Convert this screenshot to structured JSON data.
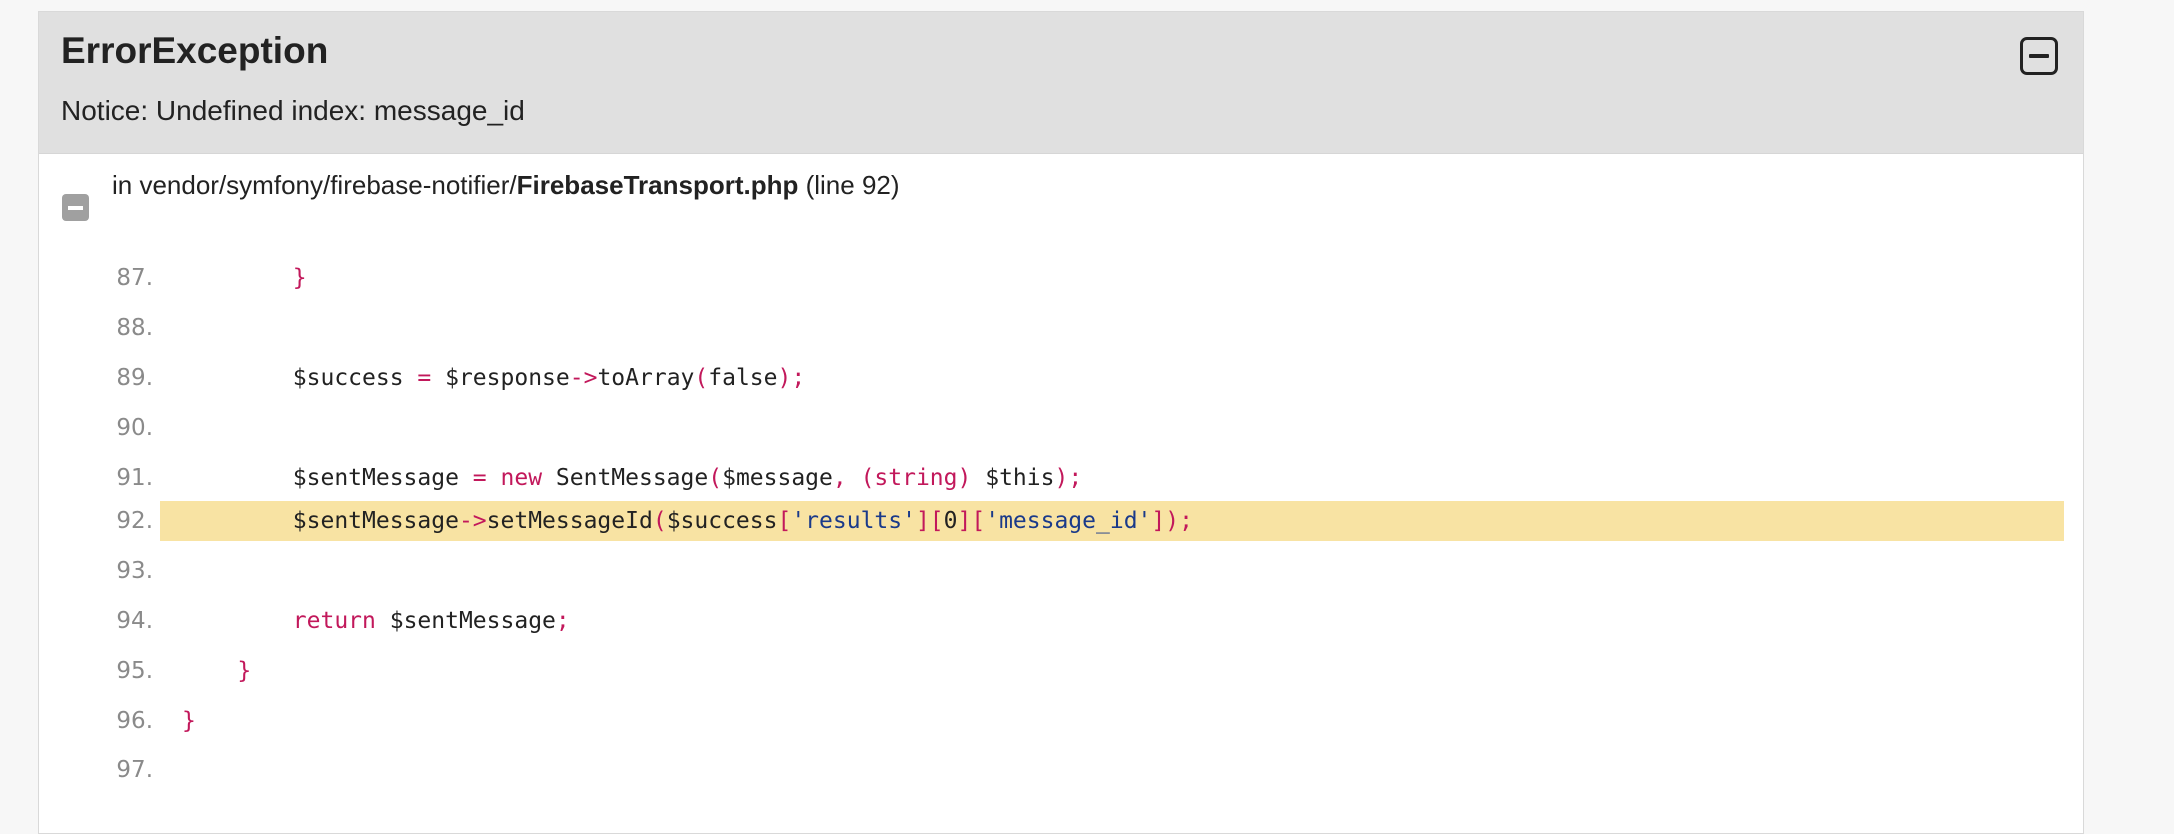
{
  "exception": {
    "class": "ErrorException",
    "message": "Notice: Undefined index: message_id"
  },
  "trace": {
    "location_prefix": "in vendor/symfony/firebase-notifier/",
    "file": "FirebaseTransport.php",
    "line_label": "(line 92)"
  },
  "icons": {
    "collapse": "minus-square-icon",
    "trace_toggle": "minus-square-icon"
  },
  "colors": {
    "header_bg": "#e0e0e0",
    "highlight_bg": "#f8e3a3",
    "punctuation": "#c2185b",
    "string": "#1a3a8a"
  },
  "code": {
    "highlighted_line": "92.",
    "lines": [
      {
        "num": "87.",
        "tokens": [
          {
            "t": "        ",
            "c": "v"
          },
          {
            "t": "}",
            "c": "p"
          }
        ]
      },
      {
        "num": "88.",
        "tokens": []
      },
      {
        "num": "89.",
        "tokens": [
          {
            "t": "        $success ",
            "c": "v"
          },
          {
            "t": "=",
            "c": "p"
          },
          {
            "t": " $response",
            "c": "v"
          },
          {
            "t": "->",
            "c": "p"
          },
          {
            "t": "toArray",
            "c": "v"
          },
          {
            "t": "(",
            "c": "p"
          },
          {
            "t": "false",
            "c": "v"
          },
          {
            "t": ");",
            "c": "p"
          }
        ]
      },
      {
        "num": "90.",
        "tokens": []
      },
      {
        "num": "91.",
        "tokens": [
          {
            "t": "        $sentMessage ",
            "c": "v"
          },
          {
            "t": "=",
            "c": "p"
          },
          {
            "t": " ",
            "c": "v"
          },
          {
            "t": "new",
            "c": "k"
          },
          {
            "t": " SentMessage",
            "c": "v"
          },
          {
            "t": "(",
            "c": "p"
          },
          {
            "t": "$message",
            "c": "v"
          },
          {
            "t": ", (",
            "c": "p"
          },
          {
            "t": "string",
            "c": "k"
          },
          {
            "t": ")",
            "c": "p"
          },
          {
            "t": " $this",
            "c": "v"
          },
          {
            "t": ");",
            "c": "p"
          }
        ]
      },
      {
        "num": "92.",
        "tokens": [
          {
            "t": "        $sentMessage",
            "c": "v"
          },
          {
            "t": "->",
            "c": "p"
          },
          {
            "t": "setMessageId",
            "c": "v"
          },
          {
            "t": "(",
            "c": "p"
          },
          {
            "t": "$success",
            "c": "v"
          },
          {
            "t": "[",
            "c": "p"
          },
          {
            "t": "'results'",
            "c": "s"
          },
          {
            "t": "][",
            "c": "p"
          },
          {
            "t": "0",
            "c": "v"
          },
          {
            "t": "][",
            "c": "p"
          },
          {
            "t": "'message_id'",
            "c": "s"
          },
          {
            "t": "]);",
            "c": "p"
          }
        ]
      },
      {
        "num": "93.",
        "tokens": []
      },
      {
        "num": "94.",
        "tokens": [
          {
            "t": "        ",
            "c": "v"
          },
          {
            "t": "return",
            "c": "k"
          },
          {
            "t": " $sentMessage",
            "c": "v"
          },
          {
            "t": ";",
            "c": "p"
          }
        ]
      },
      {
        "num": "95.",
        "tokens": [
          {
            "t": "    ",
            "c": "v"
          },
          {
            "t": "}",
            "c": "p"
          }
        ]
      },
      {
        "num": "96.",
        "tokens": [
          {
            "t": "}",
            "c": "p"
          }
        ]
      },
      {
        "num": "97.",
        "tokens": []
      }
    ]
  }
}
